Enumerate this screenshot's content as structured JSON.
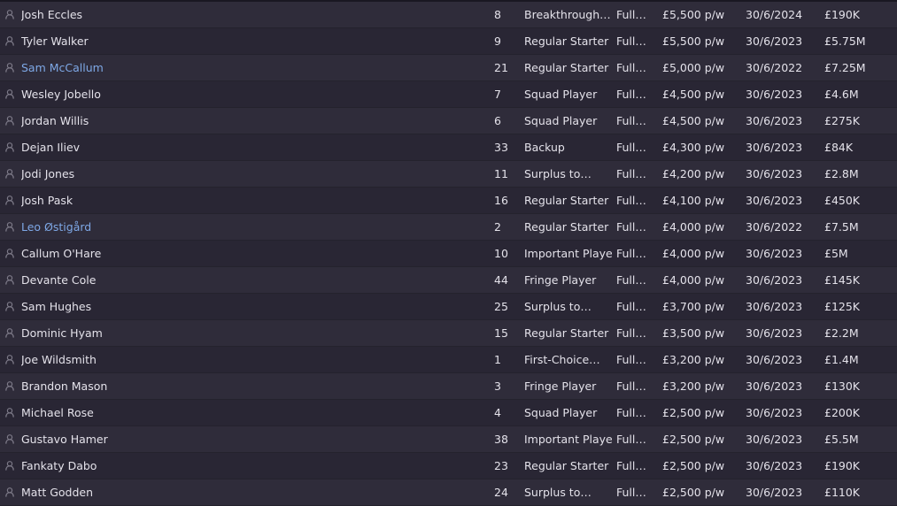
{
  "players": [
    {
      "name": "Josh Eccles",
      "num": "8",
      "status": "Breakthrough…",
      "type": "Full…",
      "wage": "£5,500 p/w",
      "expiry": "30/6/2024",
      "value": "£190K",
      "link": false
    },
    {
      "name": "Tyler Walker",
      "num": "9",
      "status": "Regular Starter",
      "type": "Full…",
      "wage": "£5,500 p/w",
      "expiry": "30/6/2023",
      "value": "£5.75M",
      "link": false
    },
    {
      "name": "Sam McCallum",
      "num": "21",
      "status": "Regular Starter",
      "type": "Full…",
      "wage": "£5,000 p/w",
      "expiry": "30/6/2022",
      "value": "£7.25M",
      "link": true
    },
    {
      "name": "Wesley Jobello",
      "num": "7",
      "status": "Squad Player",
      "type": "Full…",
      "wage": "£4,500 p/w",
      "expiry": "30/6/2023",
      "value": "£4.6M",
      "link": false
    },
    {
      "name": "Jordan Willis",
      "num": "6",
      "status": "Squad Player",
      "type": "Full…",
      "wage": "£4,500 p/w",
      "expiry": "30/6/2023",
      "value": "£275K",
      "link": false
    },
    {
      "name": "Dejan Iliev",
      "num": "33",
      "status": "Backup",
      "type": "Full…",
      "wage": "£4,300 p/w",
      "expiry": "30/6/2023",
      "value": "£84K",
      "link": false
    },
    {
      "name": "Jodi Jones",
      "num": "11",
      "status": "Surplus to…",
      "type": "Full…",
      "wage": "£4,200 p/w",
      "expiry": "30/6/2023",
      "value": "£2.8M",
      "link": false
    },
    {
      "name": "Josh Pask",
      "num": "16",
      "status": "Regular Starter",
      "type": "Full…",
      "wage": "£4,100 p/w",
      "expiry": "30/6/2023",
      "value": "£450K",
      "link": false
    },
    {
      "name": "Leo Østigård",
      "num": "2",
      "status": "Regular Starter",
      "type": "Full…",
      "wage": "£4,000 p/w",
      "expiry": "30/6/2022",
      "value": "£7.5M",
      "link": true
    },
    {
      "name": "Callum O'Hare",
      "num": "10",
      "status": "Important Player",
      "type": "Full…",
      "wage": "£4,000 p/w",
      "expiry": "30/6/2023",
      "value": "£5M",
      "link": false
    },
    {
      "name": "Devante Cole",
      "num": "44",
      "status": "Fringe Player",
      "type": "Full…",
      "wage": "£4,000 p/w",
      "expiry": "30/6/2023",
      "value": "£145K",
      "link": false
    },
    {
      "name": "Sam Hughes",
      "num": "25",
      "status": "Surplus to…",
      "type": "Full…",
      "wage": "£3,700 p/w",
      "expiry": "30/6/2023",
      "value": "£125K",
      "link": false
    },
    {
      "name": "Dominic Hyam",
      "num": "15",
      "status": "Regular Starter",
      "type": "Full…",
      "wage": "£3,500 p/w",
      "expiry": "30/6/2023",
      "value": "£2.2M",
      "link": false
    },
    {
      "name": "Joe Wildsmith",
      "num": "1",
      "status": "First-Choice…",
      "type": "Full…",
      "wage": "£3,200 p/w",
      "expiry": "30/6/2023",
      "value": "£1.4M",
      "link": false
    },
    {
      "name": "Brandon Mason",
      "num": "3",
      "status": "Fringe Player",
      "type": "Full…",
      "wage": "£3,200 p/w",
      "expiry": "30/6/2023",
      "value": "£130K",
      "link": false
    },
    {
      "name": "Michael Rose",
      "num": "4",
      "status": "Squad Player",
      "type": "Full…",
      "wage": "£2,500 p/w",
      "expiry": "30/6/2023",
      "value": "£200K",
      "link": false
    },
    {
      "name": "Gustavo Hamer",
      "num": "38",
      "status": "Important Player",
      "type": "Full…",
      "wage": "£2,500 p/w",
      "expiry": "30/6/2023",
      "value": "£5.5M",
      "link": false
    },
    {
      "name": "Fankaty Dabo",
      "num": "23",
      "status": "Regular Starter",
      "type": "Full…",
      "wage": "£2,500 p/w",
      "expiry": "30/6/2023",
      "value": "£190K",
      "link": false
    },
    {
      "name": "Matt Godden",
      "num": "24",
      "status": "Surplus to…",
      "type": "Full…",
      "wage": "£2,500 p/w",
      "expiry": "30/6/2023",
      "value": "£110K",
      "link": false
    }
  ],
  "icons": {
    "row_icon": "person-icon"
  },
  "colors": {
    "link": "#7ea8e6",
    "text": "#e4e2ea"
  }
}
